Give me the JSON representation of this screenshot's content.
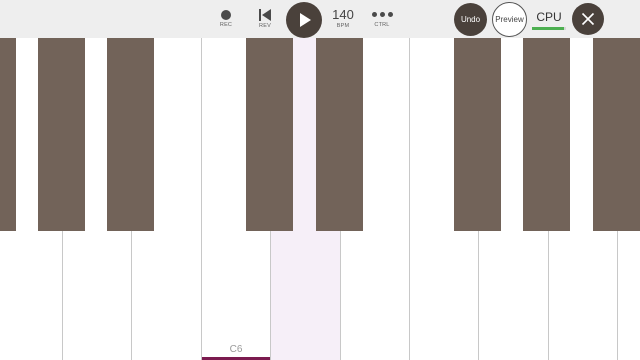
{
  "toolbar": {
    "rec": {
      "caption": "REC",
      "icon": "record-icon"
    },
    "rev": {
      "caption": "REV",
      "icon": "skip-back-icon"
    },
    "play": {
      "icon": "play-icon"
    },
    "bpm": {
      "value": "140",
      "caption": "BPM"
    },
    "ctrl": {
      "caption": "CTRL",
      "icon": "more-dots-icon"
    },
    "undo_label": "Undo",
    "preview_label": "Preview",
    "cpu": {
      "label": "CPU",
      "level": 0.95,
      "color": "#4caf50"
    },
    "close": {
      "icon": "close-icon"
    }
  },
  "keyboard": {
    "white_key_color": "#ffffff",
    "black_key_color": "#726359",
    "highlight_color": "#f6eff8",
    "marker_color": "#7b1b4f",
    "labeled_key": {
      "label": "C6"
    },
    "highlighted_key": "C#6 / D6 region"
  }
}
